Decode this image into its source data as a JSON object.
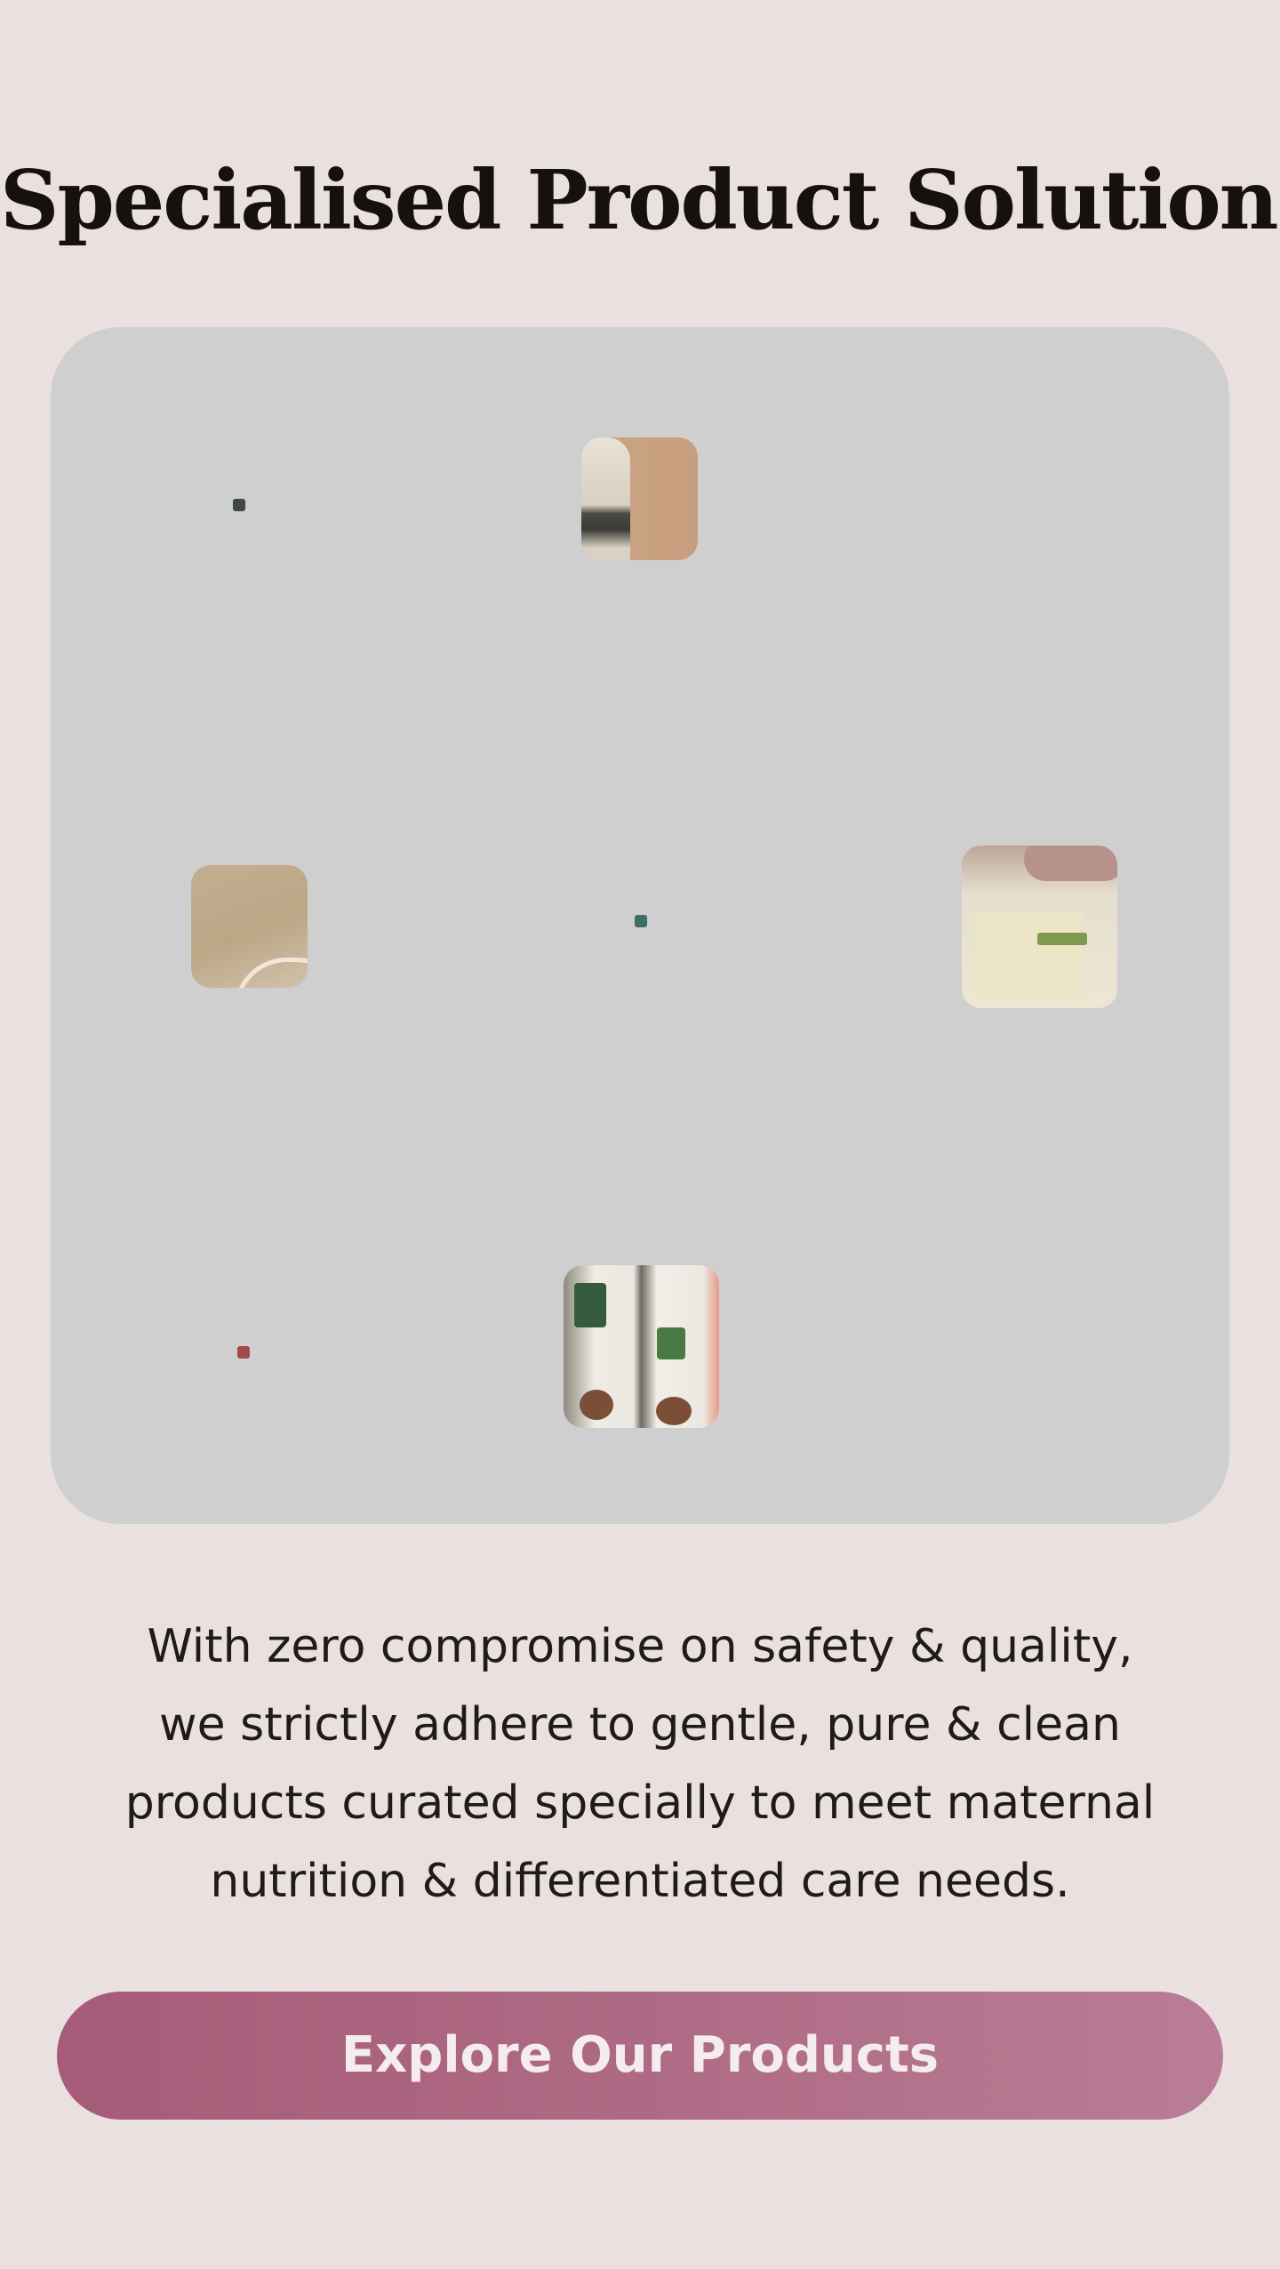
{
  "page": {
    "title": "Specialised Product Solutions"
  },
  "description": {
    "lines": [
      "With zero compromise on safety & quality,",
      "we strictly adhere to gentle, pure & clean",
      "products curated specially to meet maternal",
      "nutrition & differentiated care needs."
    ]
  },
  "cta": {
    "label": "Explore Our Products"
  },
  "colors": {
    "background": "#eae0e0",
    "gallery_background": "#cfcfcf",
    "cta_start": "#a65c78",
    "cta_end": "#b97d95",
    "cta_text": "#f5ecee",
    "heading": "#15110f"
  }
}
